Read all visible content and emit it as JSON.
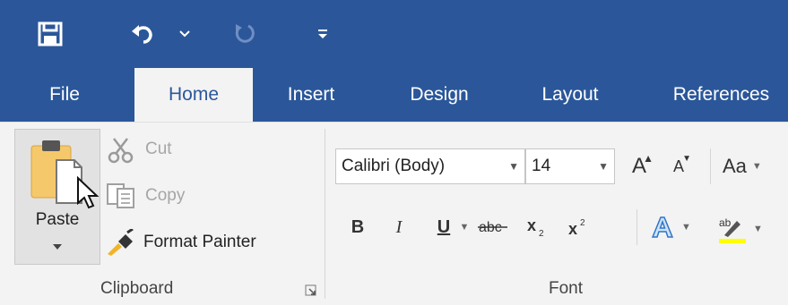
{
  "tabs": [
    "File",
    "Home",
    "Insert",
    "Design",
    "Layout",
    "References"
  ],
  "clipboard": {
    "paste_label": "Paste",
    "cut_label": "Cut",
    "copy_label": "Copy",
    "format_painter_label": "Format Painter",
    "group_label": "Clipboard"
  },
  "font": {
    "font_name": "Calibri (Body)",
    "font_size": "14",
    "change_case_label": "Aa",
    "bold_label": "B",
    "italic_label": "I",
    "underline_label": "U",
    "group_label": "Font"
  },
  "colors": {
    "accent": "#2b579a",
    "ribbon_bg": "#f3f3f3",
    "highlight": "#ffff00",
    "paste_clipboard": "#f5c86b"
  }
}
